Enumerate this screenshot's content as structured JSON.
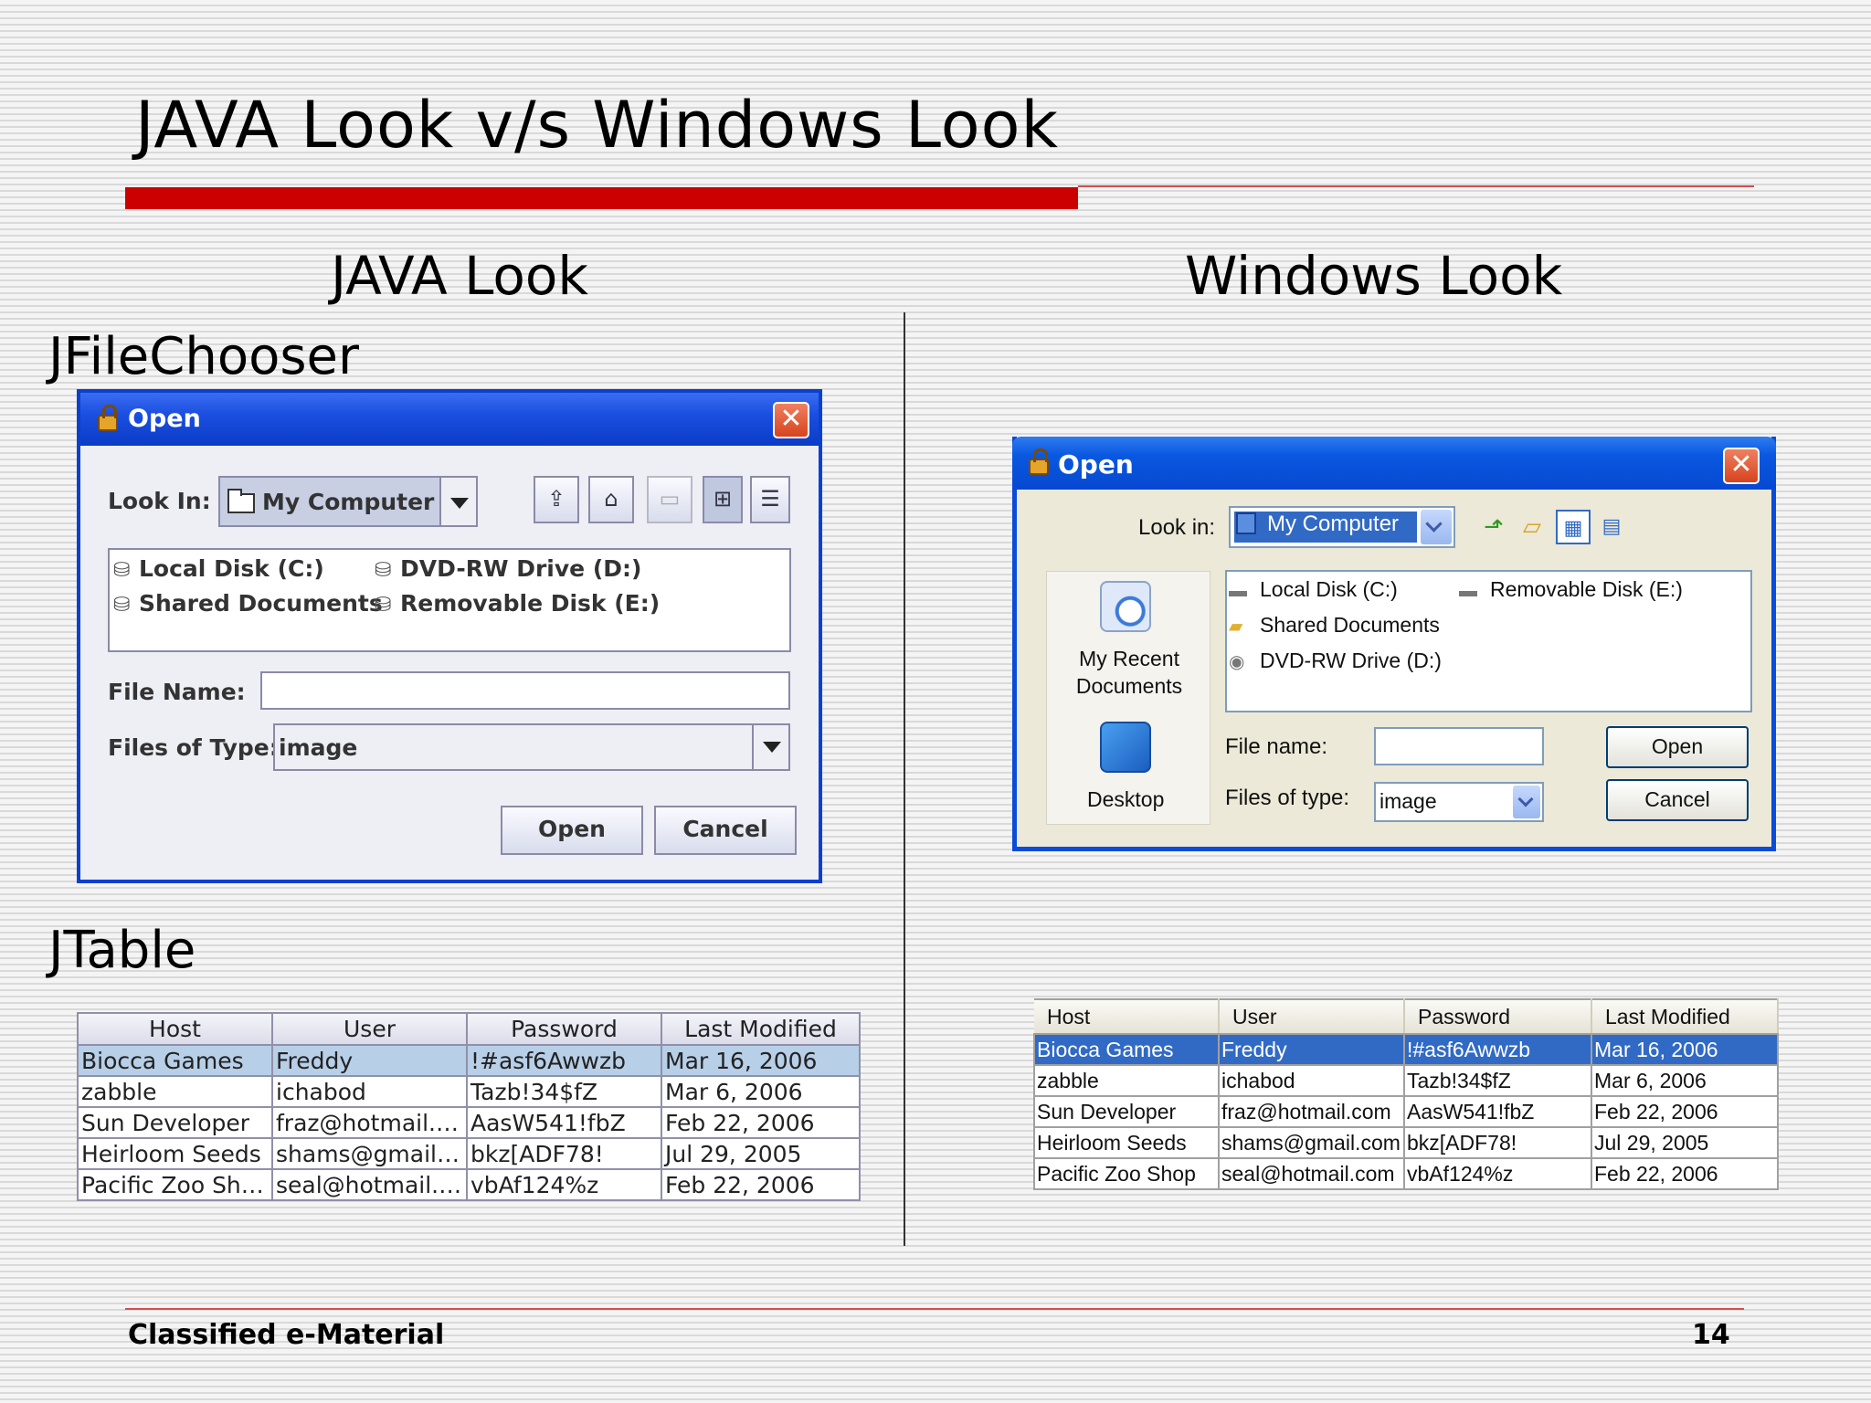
{
  "slide": {
    "title": "JAVA Look v/s Windows Look",
    "java_heading": "JAVA Look",
    "windows_heading": "Windows Look",
    "section_filechooser": "JFileChooser",
    "section_jtable": "JTable",
    "footer_left": "Classified e-Material",
    "footer_right": "14",
    "accent_color": "#cc0000"
  },
  "java_dialog": {
    "title": "Open",
    "close_label": "✕",
    "look_in_label": "Look In:",
    "look_in_value": "My Computer",
    "toolbar_icons": [
      "up-folder-icon",
      "home-icon",
      "new-folder-icon",
      "list-view-icon",
      "details-view-icon"
    ],
    "files": [
      "Local Disk (C:)",
      "DVD-RW Drive (D:)",
      "Shared Documents",
      "Removable Disk (E:)"
    ],
    "file_name_label": "File Name:",
    "file_name_value": "",
    "files_of_type_label": "Files of Type:",
    "files_of_type_value": "image",
    "open_label": "Open",
    "cancel_label": "Cancel",
    "title_bar_color": "#1b4fe0"
  },
  "windows_dialog": {
    "title": "Open",
    "close_label": "✕",
    "look_in_label": "Look in:",
    "look_in_value": "My Computer",
    "toolbar_icons": [
      "up-folder-icon",
      "new-folder-icon",
      "views-icon",
      "details-icon"
    ],
    "places": [
      "My Recent Documents",
      "Desktop"
    ],
    "files": [
      "Local Disk (C:)",
      "Removable Disk (E:)",
      "Shared Documents",
      "DVD-RW Drive (D:)"
    ],
    "file_name_label": "File name:",
    "file_name_value": "",
    "files_of_type_label": "Files of type:",
    "files_of_type_value": "image",
    "open_label": "Open",
    "cancel_label": "Cancel",
    "title_bar_color": "#0a58e0"
  },
  "java_table": {
    "columns": [
      "Host",
      "User",
      "Password",
      "Last Modified"
    ],
    "rows": [
      [
        "Biocca Games",
        "Freddy",
        "!#asf6Awwzb",
        "Mar 16, 2006"
      ],
      [
        "zabble",
        "ichabod",
        "Tazb!34$fZ",
        "Mar 6, 2006"
      ],
      [
        "Sun Developer",
        "fraz@hotmail.co...",
        "AasW541!fbZ",
        "Feb 22, 2006"
      ],
      [
        "Heirloom Seeds",
        "shams@gmail....",
        "bkz[ADF78!",
        "Jul 29, 2005"
      ],
      [
        "Pacific Zoo Shop",
        "seal@hotmail.c...",
        "vbAf124%z",
        "Feb 22, 2006"
      ]
    ],
    "selected_row": 0,
    "selection_color": "#b8cfe8"
  },
  "windows_table": {
    "columns": [
      "Host",
      "User",
      "Password",
      "Last Modified"
    ],
    "rows": [
      [
        "Biocca Games",
        "Freddy",
        "!#asf6Awwzb",
        "Mar 16, 2006"
      ],
      [
        "zabble",
        "ichabod",
        "Tazb!34$fZ",
        "Mar 6, 2006"
      ],
      [
        "Sun Developer",
        "fraz@hotmail.com",
        "AasW541!fbZ",
        "Feb 22, 2006"
      ],
      [
        "Heirloom Seeds",
        "shams@gmail.com",
        "bkz[ADF78!",
        "Jul 29, 2005"
      ],
      [
        "Pacific Zoo Shop",
        "seal@hotmail.com",
        "vbAf124%z",
        "Feb 22, 2006"
      ]
    ],
    "selected_row": 0,
    "selection_color": "#316ac5"
  }
}
